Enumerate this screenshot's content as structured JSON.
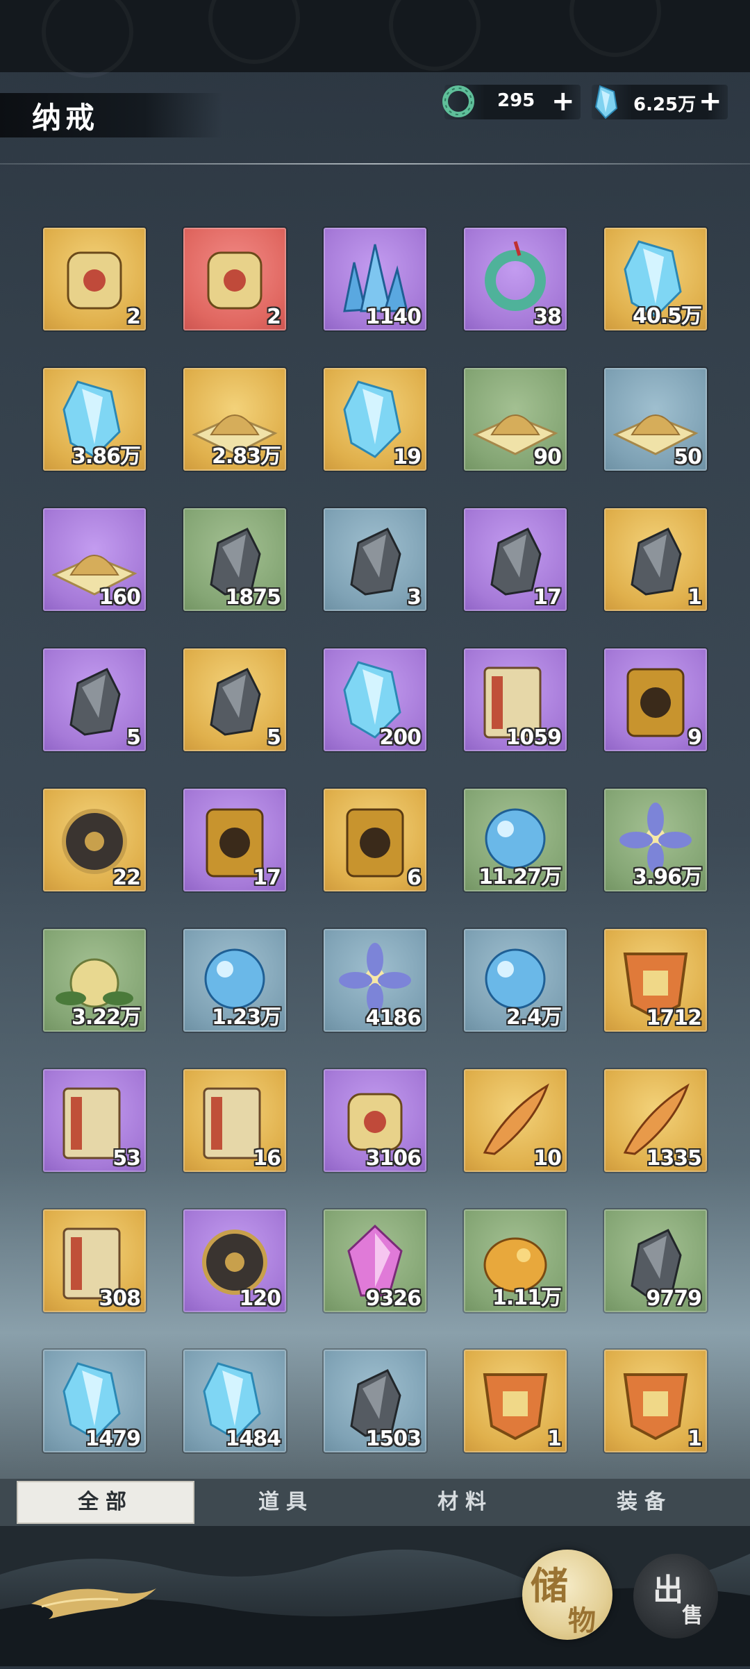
{
  "header": {
    "title": "纳戒",
    "currency_jade": {
      "icon": "jade-ring-icon",
      "value": "295",
      "add_label": "+"
    },
    "currency_crystal": {
      "icon": "blue-crystal-icon",
      "value": "6.25万",
      "add_label": "+"
    }
  },
  "items": [
    {
      "icon": "golden-dragon-ornament-icon",
      "rarity": "gold",
      "count": "2"
    },
    {
      "icon": "golden-toad-treasure-icon",
      "rarity": "red",
      "count": "2"
    },
    {
      "icon": "blue-crystal-cluster-icon",
      "rarity": "purple",
      "count": "1140"
    },
    {
      "icon": "jade-pendant-icon",
      "rarity": "purple",
      "count": "38"
    },
    {
      "icon": "blue-crystal-shard-icon",
      "rarity": "gold",
      "count": "40.5万"
    },
    {
      "icon": "blue-crystal-shard-icon",
      "rarity": "gold",
      "count": "3.86万"
    },
    {
      "icon": "purple-sand-pile-icon",
      "rarity": "gold",
      "count": "2.83万"
    },
    {
      "icon": "blue-spirit-crystal-icon",
      "rarity": "gold",
      "count": "19"
    },
    {
      "icon": "gold-sand-pile-icon",
      "rarity": "green",
      "count": "90"
    },
    {
      "icon": "gold-sand-pile-icon",
      "rarity": "blue",
      "count": "50"
    },
    {
      "icon": "gold-sand-pile-icon",
      "rarity": "purple",
      "count": "160"
    },
    {
      "icon": "iron-ore-icon",
      "rarity": "green",
      "count": "1875"
    },
    {
      "icon": "iron-ore-icon",
      "rarity": "blue",
      "count": "3"
    },
    {
      "icon": "iron-ore-icon",
      "rarity": "purple",
      "count": "17"
    },
    {
      "icon": "iron-ore-icon",
      "rarity": "gold",
      "count": "1"
    },
    {
      "icon": "gold-ore-icon",
      "rarity": "purple",
      "count": "5"
    },
    {
      "icon": "red-ore-icon",
      "rarity": "gold",
      "count": "5"
    },
    {
      "icon": "ice-crystal-icon",
      "rarity": "purple",
      "count": "200"
    },
    {
      "icon": "scroll-ticket-icon",
      "rarity": "purple",
      "count": "1059"
    },
    {
      "icon": "golden-token-icon",
      "rarity": "purple",
      "count": "9"
    },
    {
      "icon": "bagua-disc-icon",
      "rarity": "gold",
      "count": "22"
    },
    {
      "icon": "jade-tablet-icon",
      "rarity": "purple",
      "count": "17"
    },
    {
      "icon": "talisman-plaque-icon",
      "rarity": "gold",
      "count": "6"
    },
    {
      "icon": "water-spirit-orb-icon",
      "rarity": "green",
      "count": "11.27万"
    },
    {
      "icon": "blue-flower-icon",
      "rarity": "green",
      "count": "3.96万"
    },
    {
      "icon": "spirit-fruit-icon",
      "rarity": "green",
      "count": "3.22万"
    },
    {
      "icon": "purple-orb-icon",
      "rarity": "blue",
      "count": "1.23万"
    },
    {
      "icon": "white-lotus-icon",
      "rarity": "blue",
      "count": "4186"
    },
    {
      "icon": "blue-berry-icon",
      "rarity": "blue",
      "count": "2.4万"
    },
    {
      "icon": "jade-beast-charm-icon",
      "rarity": "gold",
      "count": "1712"
    },
    {
      "icon": "manual-book-icon",
      "rarity": "purple",
      "count": "53"
    },
    {
      "icon": "red-book-icon",
      "rarity": "gold",
      "count": "16"
    },
    {
      "icon": "gourd-bottle-icon",
      "rarity": "purple",
      "count": "3106"
    },
    {
      "icon": "blue-spirit-flame-icon",
      "rarity": "gold",
      "count": "10"
    },
    {
      "icon": "phoenix-feather-icon",
      "rarity": "gold",
      "count": "1335"
    },
    {
      "icon": "water-map-icon",
      "rarity": "gold",
      "count": "308"
    },
    {
      "icon": "sundial-compass-icon",
      "rarity": "purple",
      "count": "120"
    },
    {
      "icon": "pink-gem-icon",
      "rarity": "green",
      "count": "9326"
    },
    {
      "icon": "gold-nugget-icon",
      "rarity": "green",
      "count": "1.11万"
    },
    {
      "icon": "silver-ore-icon",
      "rarity": "green",
      "count": "9779"
    },
    {
      "icon": "purple-crystal-icon",
      "rarity": "blue",
      "count": "1479"
    },
    {
      "icon": "fire-gold-crystal-icon",
      "rarity": "blue",
      "count": "1484"
    },
    {
      "icon": "grey-stone-icon",
      "rarity": "blue",
      "count": "1503"
    },
    {
      "icon": "heng-amulet-icon",
      "rarity": "gold",
      "count": "1"
    },
    {
      "icon": "he-amulet-icon",
      "rarity": "gold",
      "count": "1"
    }
  ],
  "tabs": [
    {
      "label": "全部",
      "active": true
    },
    {
      "label": "道具",
      "active": false
    },
    {
      "label": "材料",
      "active": false
    },
    {
      "label": "装备",
      "active": false
    }
  ],
  "actions": {
    "store": {
      "char1": "储",
      "char2": "物"
    },
    "sell": {
      "char1": "出",
      "char2": "售"
    }
  }
}
